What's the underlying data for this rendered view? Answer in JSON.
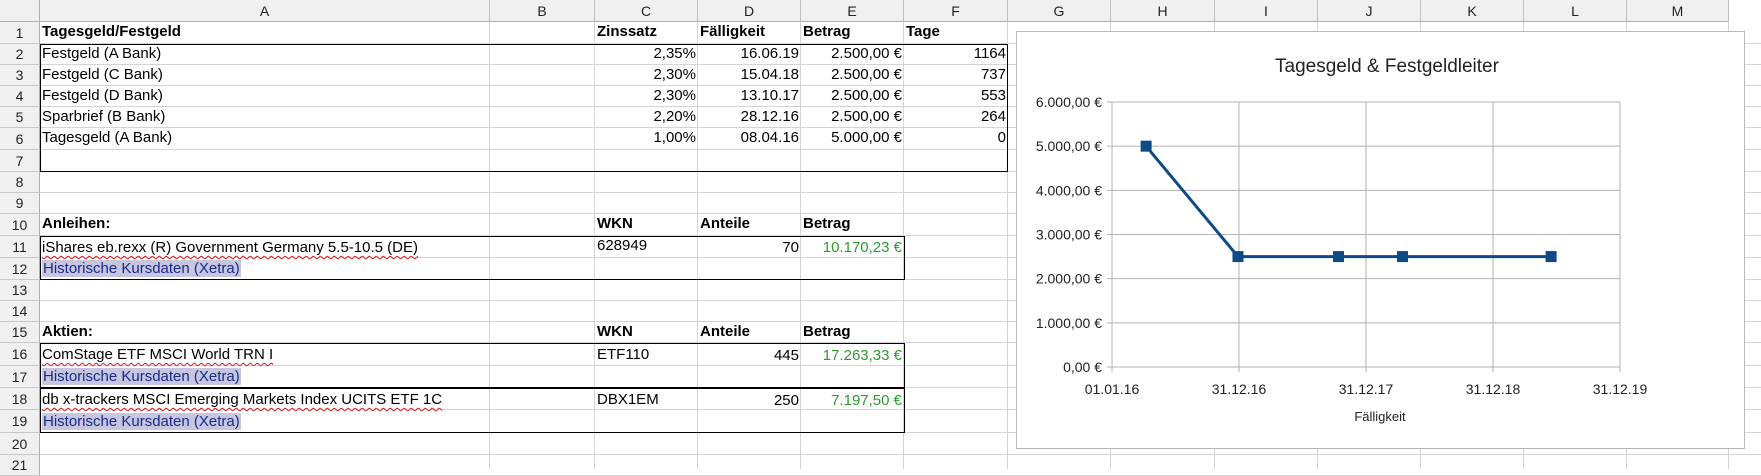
{
  "columns": [
    "A",
    "B",
    "C",
    "D",
    "E",
    "F",
    "G",
    "H",
    "I",
    "J",
    "K",
    "L",
    "M"
  ],
  "rows": [
    "1",
    "2",
    "3",
    "4",
    "5",
    "6",
    "7",
    "8",
    "9",
    "10",
    "11",
    "12",
    "13",
    "14",
    "15",
    "16",
    "17",
    "18",
    "19",
    "20",
    "21"
  ],
  "section1": {
    "header": "Tagesgeld/Festgeld",
    "col_rate": "Zinssatz",
    "col_due": "Fälligkeit",
    "col_amount": "Betrag",
    "col_days": "Tage",
    "rows": [
      {
        "name": "Festgeld (A Bank)",
        "rate": "2,35%",
        "due": "16.06.19",
        "amount": "2.500,00 €",
        "days": "1164"
      },
      {
        "name": "Festgeld (C Bank)",
        "rate": "2,30%",
        "due": "15.04.18",
        "amount": "2.500,00 €",
        "days": "737"
      },
      {
        "name": "Festgeld (D Bank)",
        "rate": "2,30%",
        "due": "13.10.17",
        "amount": "2.500,00 €",
        "days": "553"
      },
      {
        "name": "Sparbrief (B Bank)",
        "rate": "2,20%",
        "due": "28.12.16",
        "amount": "2.500,00 €",
        "days": "264"
      },
      {
        "name": "Tagesgeld (A Bank)",
        "rate": "1,00%",
        "due": "08.04.16",
        "amount": "5.000,00 €",
        "days": "0"
      }
    ]
  },
  "section2": {
    "header": "Anleihen:",
    "col_wkn": "WKN",
    "col_shares": "Anteile",
    "col_amount": "Betrag",
    "name": "iShares eb.rexx (R) Government Germany 5.5-10.5 (DE)",
    "wkn": "628949",
    "shares": "70",
    "amount": "10.170,23 €",
    "link": "Historische Kursdaten (Xetra)"
  },
  "section3": {
    "header": "Aktien:",
    "col_wkn": "WKN",
    "col_shares": "Anteile",
    "col_amount": "Betrag",
    "items": [
      {
        "name": "ComStage ETF MSCI World TRN I",
        "wkn": "ETF110",
        "shares": "445",
        "amount": "17.263,33 €",
        "link": "Historische Kursdaten (Xetra)"
      },
      {
        "name": "db x-trackers MSCI Emerging Markets Index UCITS ETF 1C",
        "wkn": "DBX1EM",
        "shares": "250",
        "amount": "7.197,50 €",
        "link": "Historische Kursdaten (Xetra)"
      }
    ]
  },
  "colors": {
    "line": "#0e4a85",
    "grid": "#b3b3b3",
    "green": "#2e9a2e",
    "link_bg": "#c6c6e0"
  },
  "chart_data": {
    "type": "line",
    "title": "Tagesgeld & Festgeldleiter",
    "xlabel": "Fälligkeit",
    "ylabel": "",
    "x_ticks": [
      "01.01.16",
      "31.12.16",
      "31.12.17",
      "31.12.18",
      "31.12.19"
    ],
    "y_ticks": [
      "0,00 €",
      "1.000,00 €",
      "2.000,00 €",
      "3.000,00 €",
      "4.000,00 €",
      "5.000,00 €",
      "6.000,00 €"
    ],
    "ylim": [
      0,
      6000
    ],
    "xlim": [
      "01.01.16",
      "31.12.19"
    ],
    "grid": true,
    "series": [
      {
        "x": [
          "08.04.16",
          "28.12.16",
          "13.10.17",
          "15.04.18",
          "16.06.19"
        ],
        "values": [
          5000,
          2500,
          2500,
          2500,
          2500
        ]
      }
    ]
  }
}
